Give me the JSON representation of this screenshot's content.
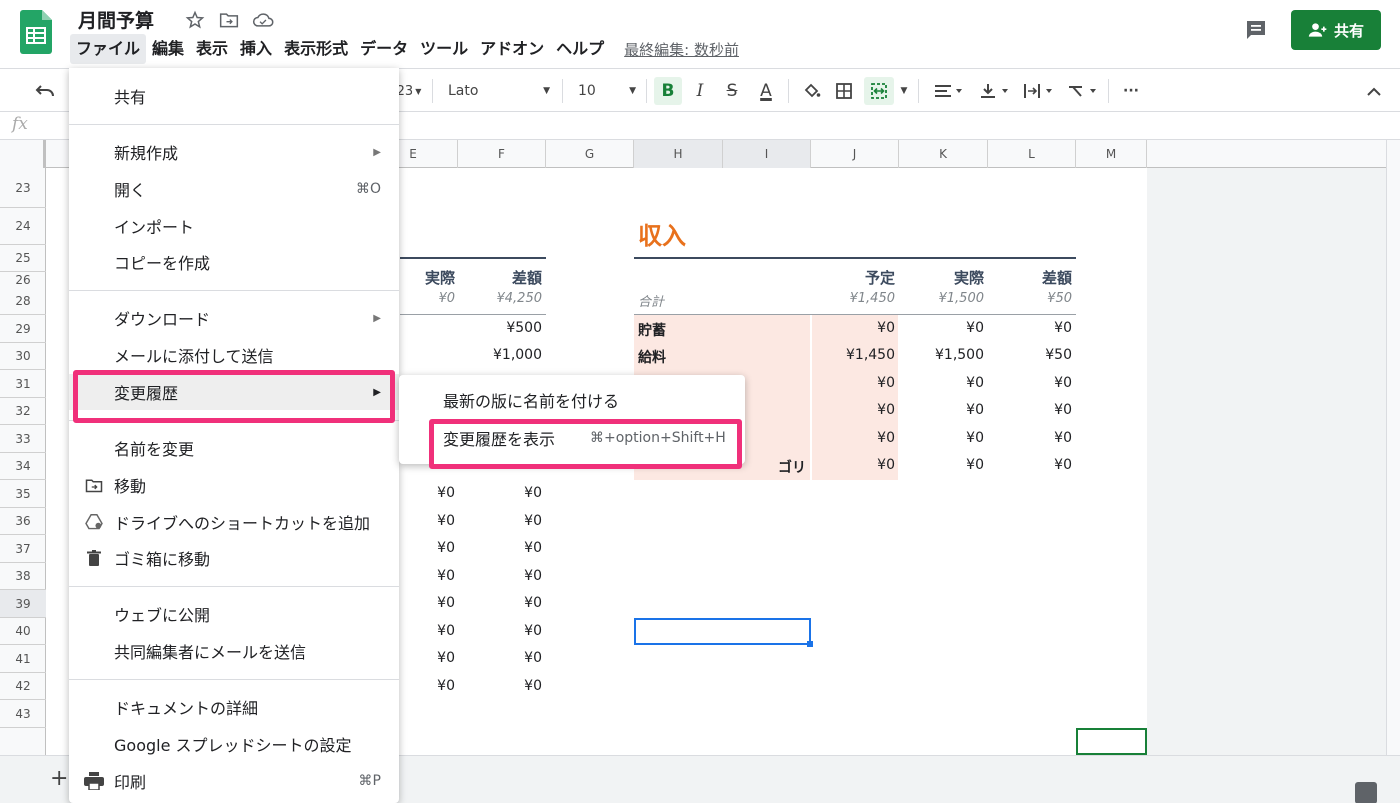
{
  "header": {
    "doc_title": "月間予算",
    "menu": [
      "ファイル",
      "編集",
      "表示",
      "挿入",
      "表示形式",
      "データ",
      "ツール",
      "アドオン",
      "ヘルプ"
    ],
    "last_edit": "最終編集: 数秒前",
    "share_label": "共有"
  },
  "toolbar": {
    "num_format": "23",
    "font": "Lato",
    "font_size": "10",
    "bold": "B",
    "italic": "I",
    "strike": "S",
    "text_color": "A",
    "more": "···"
  },
  "formula_bar": {
    "fx": "fx"
  },
  "grid": {
    "columns": [
      "E",
      "F",
      "G",
      "H",
      "I",
      "J",
      "K",
      "L",
      "M"
    ],
    "rows": [
      "23",
      "24",
      "25",
      "26",
      "28",
      "29",
      "30",
      "31",
      "32",
      "33",
      "34",
      "35",
      "36",
      "37",
      "38",
      "39",
      "40",
      "41",
      "42",
      "43"
    ],
    "left_table": {
      "headers": [
        "実際",
        "差額"
      ],
      "summary": [
        "¥0",
        "¥4,250"
      ],
      "top_rows": [
        [
          "",
          "¥500"
        ],
        [
          "",
          "¥1,000"
        ]
      ],
      "bottom_rows": [
        [
          "¥0",
          "¥0"
        ],
        [
          "¥0",
          "¥0"
        ],
        [
          "¥0",
          "¥0"
        ],
        [
          "¥0",
          "¥0"
        ],
        [
          "¥0",
          "¥0"
        ],
        [
          "¥0",
          "¥0"
        ],
        [
          "¥0",
          "¥0"
        ],
        [
          "¥0",
          "¥0"
        ]
      ]
    },
    "income": {
      "title": "収入",
      "headers": [
        "予定",
        "実際",
        "差額"
      ],
      "summary_label": "合計",
      "summary": [
        "¥1,450",
        "¥1,500",
        "¥50"
      ],
      "rows": [
        {
          "label": "貯蓄",
          "values": [
            "¥0",
            "¥0",
            "¥0"
          ]
        },
        {
          "label": "給料",
          "values": [
            "¥1,450",
            "¥1,500",
            "¥50"
          ]
        },
        {
          "label": "",
          "values": [
            "¥0",
            "¥0",
            "¥0"
          ]
        },
        {
          "label": "",
          "values": [
            "¥0",
            "¥0",
            "¥0"
          ]
        },
        {
          "label": "",
          "values": [
            "¥0",
            "¥0",
            "¥0"
          ]
        },
        {
          "label": "ゴリ",
          "values": [
            "¥0",
            "¥0",
            "¥0"
          ]
        }
      ]
    }
  },
  "file_menu": {
    "share": "共有",
    "new": "新規作成",
    "open": "開く",
    "open_shortcut": "⌘O",
    "import": "インポート",
    "make_copy": "コピーを作成",
    "download": "ダウンロード",
    "email_attach": "メールに添付して送信",
    "version_history": "変更履歴",
    "rename": "名前を変更",
    "move": "移動",
    "add_shortcut": "ドライブへのショートカットを追加",
    "trash": "ゴミ箱に移動",
    "publish": "ウェブに公開",
    "email_collab": "共同編集者にメールを送信",
    "details": "ドキュメントの詳細",
    "settings": "Google スプレッドシートの設定",
    "print": "印刷",
    "print_shortcut": "⌘P"
  },
  "submenu": {
    "name_version": "最新の版に名前を付ける",
    "see_history": "変更履歴を表示",
    "see_history_shortcut": "⌘+option+Shift+H"
  },
  "colors": {
    "accent_green": "#188038",
    "income_orange": "#e8711c",
    "highlight_pink": "#f0307a",
    "income_row_bg": "#fce8e2"
  }
}
